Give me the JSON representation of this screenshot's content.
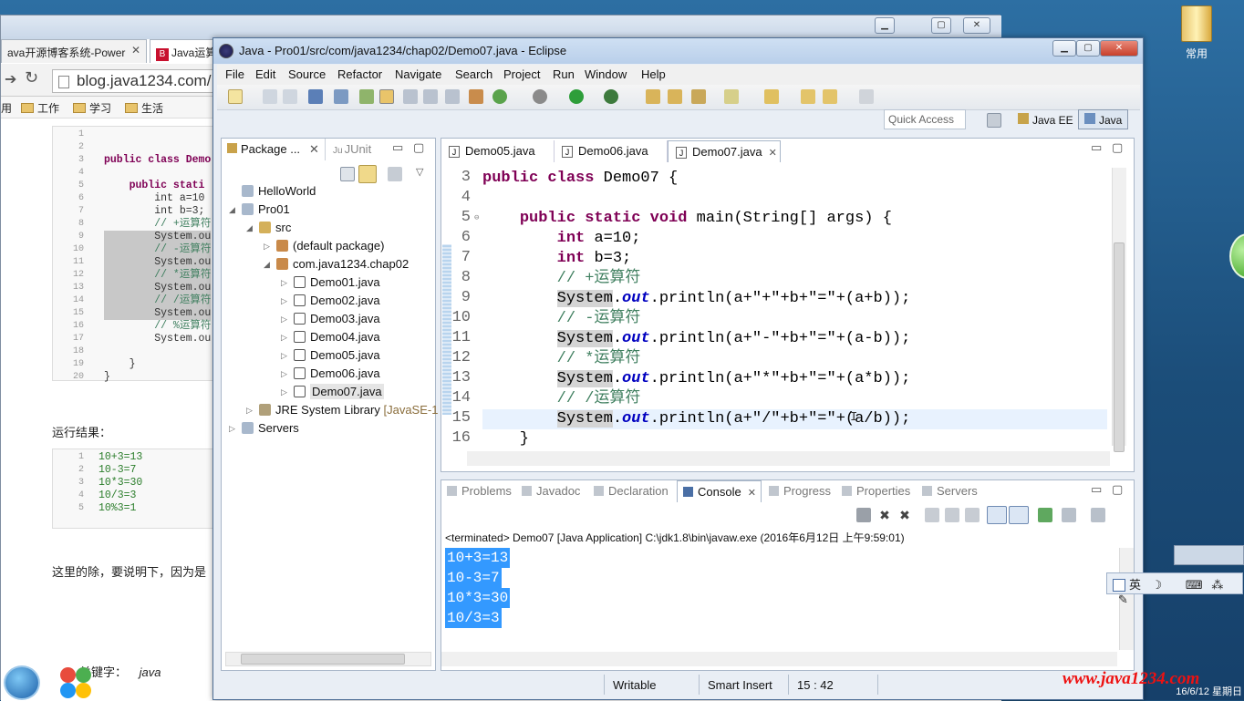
{
  "desktop": {
    "icon_label": "常用"
  },
  "browser": {
    "tab1": "ava开源博客系统-Power",
    "tab1_close": "✕",
    "tab2": "Java运算",
    "url": "blog.java1234.com/",
    "bookmarks": [
      "用",
      "工作",
      "学习",
      "生活"
    ],
    "code_line_numbers": [
      "1",
      "2",
      "3",
      "4",
      "5",
      "6",
      "7",
      "8",
      "9",
      "10",
      "11",
      "12",
      "13",
      "14",
      "15",
      "16",
      "17",
      "18",
      "19",
      "20"
    ],
    "code": [
      {
        "text": "",
        "cls": ""
      },
      {
        "text": "",
        "cls": ""
      },
      {
        "text": "public class Demo",
        "cls": "kw"
      },
      {
        "text": "",
        "cls": ""
      },
      {
        "text": "    public stati",
        "cls": "kw"
      },
      {
        "text": "        int a=10",
        "cls": ""
      },
      {
        "text": "        int b=3;",
        "cls": ""
      },
      {
        "text": "        // +运算符",
        "cls": "cm"
      },
      {
        "text": "        System.ou",
        "cls": "hl"
      },
      {
        "text": "        // -运算符",
        "cls": "cm hl"
      },
      {
        "text": "        System.ou",
        "cls": "hl"
      },
      {
        "text": "        // *运算符",
        "cls": "cm hl"
      },
      {
        "text": "        System.ou",
        "cls": "hl"
      },
      {
        "text": "        // /运算符",
        "cls": "cm hl"
      },
      {
        "text": "        System.ou",
        "cls": "hl"
      },
      {
        "text": "        // %运算符",
        "cls": "cm"
      },
      {
        "text": "        System.ou",
        "cls": ""
      },
      {
        "text": "",
        "cls": ""
      },
      {
        "text": "    }",
        "cls": ""
      },
      {
        "text": "}",
        "cls": ""
      }
    ],
    "result_label": "运行结果：",
    "result_line_numbers": [
      "1",
      "2",
      "3",
      "4",
      "5"
    ],
    "result_lines": [
      "10+3=13",
      "10-3=7",
      "10*3=30",
      "10/3=3",
      "10%3=1"
    ],
    "para": "这里的除，要说明下，因为是",
    "keyword_label": "关键字：",
    "keyword_value": "java"
  },
  "eclipse": {
    "title": "Java - Pro01/src/com/java1234/chap02/Demo07.java - Eclipse",
    "menus": [
      "File",
      "Edit",
      "Source",
      "Refactor",
      "Navigate",
      "Search",
      "Project",
      "Run",
      "Window",
      "Help"
    ],
    "quick_access": "Quick Access",
    "perspectives": [
      "Java EE",
      "Java"
    ],
    "package_tab": "Package ...",
    "junit_tab": "JUnit",
    "tree": [
      {
        "label": "HelloWorld",
        "depth": 0,
        "icon": "project",
        "twisty": ""
      },
      {
        "label": "Pro01",
        "depth": 0,
        "icon": "project",
        "twisty": "◢"
      },
      {
        "label": "src",
        "depth": 1,
        "icon": "srcfolder",
        "twisty": "◢"
      },
      {
        "label": "(default package)",
        "depth": 2,
        "icon": "package",
        "twisty": "▷"
      },
      {
        "label": "com.java1234.chap02",
        "depth": 2,
        "icon": "package",
        "twisty": "◢"
      },
      {
        "label": "Demo01.java",
        "depth": 3,
        "icon": "java",
        "twisty": "▷"
      },
      {
        "label": "Demo02.java",
        "depth": 3,
        "icon": "java",
        "twisty": "▷"
      },
      {
        "label": "Demo03.java",
        "depth": 3,
        "icon": "java",
        "twisty": "▷"
      },
      {
        "label": "Demo04.java",
        "depth": 3,
        "icon": "java",
        "twisty": "▷"
      },
      {
        "label": "Demo05.java",
        "depth": 3,
        "icon": "java",
        "twisty": "▷"
      },
      {
        "label": "Demo06.java",
        "depth": 3,
        "icon": "java",
        "twisty": "▷"
      },
      {
        "label": "Demo07.java",
        "depth": 3,
        "icon": "java",
        "twisty": "▷",
        "selected": true
      },
      {
        "label": "JRE System Library",
        "suffix": "[JavaSE-1",
        "depth": 1,
        "icon": "library",
        "twisty": "▷"
      },
      {
        "label": "Servers",
        "depth": 0,
        "icon": "project",
        "twisty": "▷"
      }
    ],
    "editor_tabs": [
      {
        "label": "Demo05.java",
        "active": false
      },
      {
        "label": "Demo06.java",
        "active": false
      },
      {
        "label": "Demo07.java",
        "active": true
      }
    ],
    "editor_lines": [
      {
        "num": "3",
        "html_key": "l3"
      },
      {
        "num": "4",
        "html_key": "l4"
      },
      {
        "num": "5",
        "html_key": "l5"
      },
      {
        "num": "6",
        "html_key": "l6"
      },
      {
        "num": "7",
        "html_key": "l7"
      },
      {
        "num": "8",
        "html_key": "l8"
      },
      {
        "num": "9",
        "html_key": "l9"
      },
      {
        "num": "10",
        "html_key": "l10"
      },
      {
        "num": "11",
        "html_key": "l11"
      },
      {
        "num": "12",
        "html_key": "l12"
      },
      {
        "num": "13",
        "html_key": "l13"
      },
      {
        "num": "14",
        "html_key": "l14"
      },
      {
        "num": "15",
        "html_key": "l15"
      },
      {
        "num": "16",
        "html_key": "l16"
      }
    ],
    "code": {
      "l3": [
        [
          "kw",
          "public class "
        ],
        [
          "",
          "Demo07 {"
        ]
      ],
      "l4": [],
      "l5": [
        [
          "",
          "    "
        ],
        [
          "kw",
          "public static void "
        ],
        [
          "",
          "main(String[] args) {"
        ]
      ],
      "l6": [
        [
          "",
          "        "
        ],
        [
          "kw",
          "int "
        ],
        [
          "",
          "a=10;"
        ]
      ],
      "l7": [
        [
          "",
          "        "
        ],
        [
          "kw",
          "int "
        ],
        [
          "",
          "b=3;"
        ]
      ],
      "l8": [
        [
          "",
          "        "
        ],
        [
          "cm",
          "// +运算符"
        ]
      ],
      "l9": [
        [
          "",
          "        "
        ],
        [
          "sys",
          "System"
        ],
        [
          "",
          "."
        ],
        [
          "fld",
          "out"
        ],
        [
          "",
          ".println(a+\"+\"+b+\"=\"+(a+b));"
        ]
      ],
      "l10": [
        [
          "",
          "        "
        ],
        [
          "cm",
          "// -运算符"
        ]
      ],
      "l11": [
        [
          "",
          "        "
        ],
        [
          "sys",
          "System"
        ],
        [
          "",
          "."
        ],
        [
          "fld",
          "out"
        ],
        [
          "",
          ".println(a+\"-\"+b+\"=\"+(a-b));"
        ]
      ],
      "l12": [
        [
          "",
          "        "
        ],
        [
          "cm",
          "// *运算符"
        ]
      ],
      "l13": [
        [
          "",
          "        "
        ],
        [
          "sys",
          "System"
        ],
        [
          "",
          "."
        ],
        [
          "fld",
          "out"
        ],
        [
          "",
          ".println(a+\"*\"+b+\"=\"+(a*b));"
        ]
      ],
      "l14": [
        [
          "",
          "        "
        ],
        [
          "cm",
          "// /运算符"
        ]
      ],
      "l15": [
        [
          "",
          "        "
        ],
        [
          "sys",
          "System"
        ],
        [
          "",
          "."
        ],
        [
          "fld",
          "out"
        ],
        [
          "",
          ".println(a+\"/\"+b+\"=\"+(a/b));"
        ]
      ],
      "l16": [
        [
          "",
          "    }"
        ]
      ]
    },
    "console_tabs": [
      {
        "label": "Problems",
        "active": false
      },
      {
        "label": "Javadoc",
        "active": false
      },
      {
        "label": "Declaration",
        "active": false
      },
      {
        "label": "Console",
        "active": true
      },
      {
        "label": "Progress",
        "active": false
      },
      {
        "label": "Properties",
        "active": false
      },
      {
        "label": "Servers",
        "active": false
      }
    ],
    "terminated": "<terminated> Demo07 [Java Application] C:\\jdk1.8\\bin\\javaw.exe (2016年6月12日 上午9:59:01)",
    "output": [
      "10+3=13",
      "10-3=7",
      "10*3=30",
      "10/3=3"
    ],
    "status": {
      "writable": "Writable",
      "insert": "Smart Insert",
      "position": "15 : 42"
    }
  },
  "ime": {
    "lang": "英"
  },
  "watermark": "www.java1234.com",
  "clock": {
    "date": "16/6/12 星期日"
  }
}
